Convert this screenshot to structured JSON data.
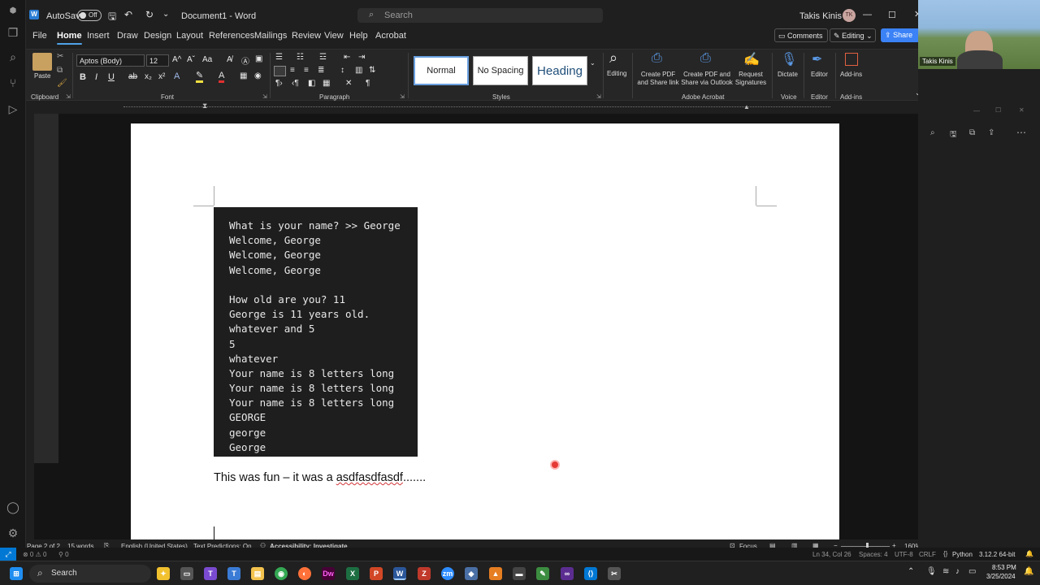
{
  "word": {
    "autosave_label": "AutoSave",
    "autosave_state": "Off",
    "doc_title": "Document1 - Word",
    "search_placeholder": "Search",
    "user_name": "Takis Kinis",
    "user_initials": "TK",
    "menu": [
      "File",
      "Home",
      "Insert",
      "Draw",
      "Design",
      "Layout",
      "References",
      "Mailings",
      "Review",
      "View",
      "Help",
      "Acrobat"
    ],
    "active_tab": "Home",
    "comments_label": "Comments",
    "editing_label": "Editing",
    "share_label": "Share"
  },
  "ribbon": {
    "clipboard": {
      "paste": "Paste",
      "label": "Clipboard"
    },
    "font": {
      "name": "Aptos (Body)",
      "size": "12",
      "label": "Font"
    },
    "paragraph": {
      "label": "Paragraph"
    },
    "styles": {
      "normal": "Normal",
      "no_spacing": "No Spacing",
      "heading": "Heading",
      "label": "Styles"
    },
    "editing": {
      "label": "Editing"
    },
    "acrobat": {
      "create_pdf_share": "Create PDF and Share link",
      "create_pdf_outlook": "Create PDF and Share via Outlook",
      "request_signatures": "Request Signatures",
      "label": "Adobe Acrobat"
    },
    "voice": {
      "dictate": "Dictate",
      "label": "Voice"
    },
    "editor": {
      "editor": "Editor",
      "label": "Editor"
    },
    "addins": {
      "addins": "Add-ins",
      "label": "Add-ins"
    }
  },
  "document": {
    "code_lines": [
      "What is your name? >> George",
      "Welcome, George",
      "Welcome, George",
      "Welcome, George",
      "",
      "How old are you? 11",
      "George is 11 years old.",
      "whatever and 5",
      "5",
      "whatever",
      "Your name is 8 letters long",
      "Your name is 8 letters long",
      "Your name is 8 letters long",
      "GEORGE",
      "george",
      "George"
    ],
    "text_before": "This was fun – it was a ",
    "text_misspelled": "asdfasdfasdf",
    "text_after": "......."
  },
  "status": {
    "page": "Page 2 of 2",
    "words": "15 words",
    "language": "English (United States)",
    "text_predictions": "Text Predictions: On",
    "accessibility": "Accessibility: Investigate",
    "focus": "Focus",
    "zoom": "160%"
  },
  "vscode_status": {
    "position": "Ln 34, Col 26",
    "spaces": "Spaces: 4",
    "encoding": "UTF-8",
    "eol": "CRLF",
    "language": "Python",
    "interpreter": "3.12.2 64-bit"
  },
  "webcam": {
    "name": "Takis Kinis"
  },
  "taskbar": {
    "search": "Search",
    "time": "8:53 PM",
    "date": "3/25/2024"
  },
  "colors": {
    "accent": "#4fa3e8",
    "share": "#3b82f6",
    "code_bg": "#1e1e1e",
    "misspelling": "#d13438"
  }
}
